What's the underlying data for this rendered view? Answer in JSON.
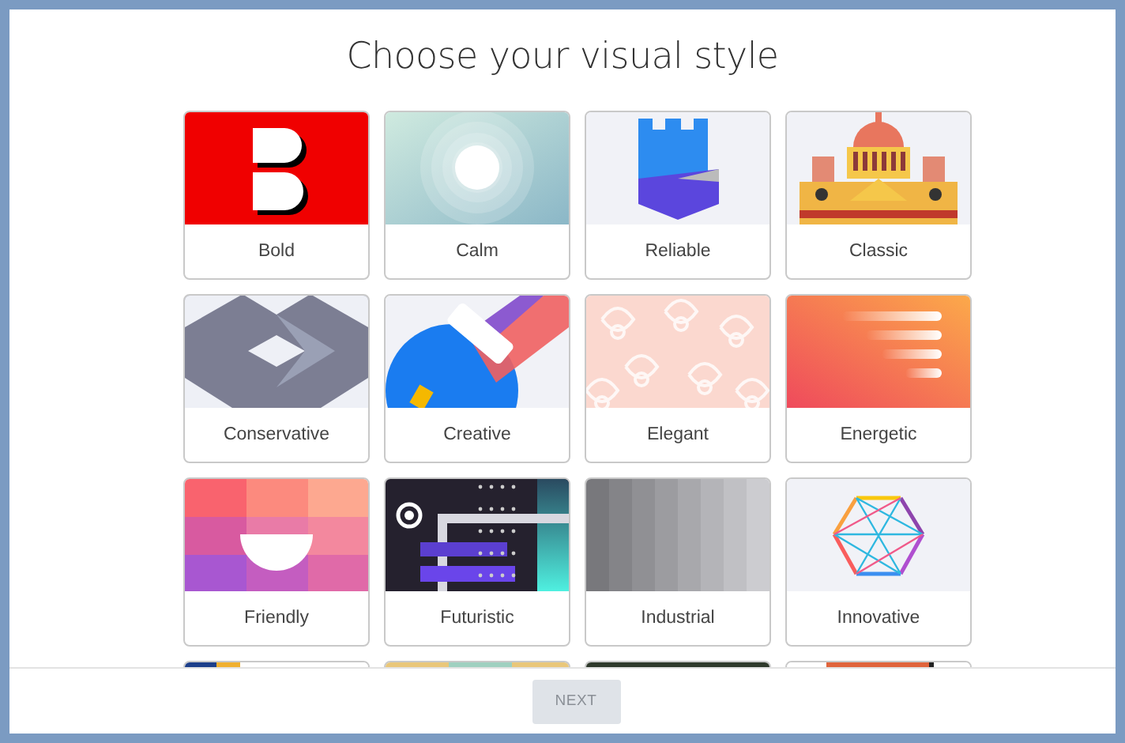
{
  "title": "Choose your visual style",
  "styles": [
    {
      "label": "Bold",
      "kind": "bold",
      "selected": false
    },
    {
      "label": "Calm",
      "kind": "calm",
      "selected": false
    },
    {
      "label": "Reliable",
      "kind": "reliable",
      "selected": false
    },
    {
      "label": "Classic",
      "kind": "classic",
      "selected": false
    },
    {
      "label": "Conservative",
      "kind": "conservative",
      "selected": false
    },
    {
      "label": "Creative",
      "kind": "creative",
      "selected": false
    },
    {
      "label": "Elegant",
      "kind": "elegant",
      "selected": false
    },
    {
      "label": "Energetic",
      "kind": "energetic",
      "selected": false
    },
    {
      "label": "Friendly",
      "kind": "friendly",
      "selected": false
    },
    {
      "label": "Futuristic",
      "kind": "futuristic",
      "selected": false
    },
    {
      "label": "Industrial",
      "kind": "industrial",
      "selected": false
    },
    {
      "label": "Innovative",
      "kind": "innovative",
      "selected": false
    }
  ],
  "partial_row": [
    {
      "kind": "navy-amber"
    },
    {
      "kind": "sand"
    },
    {
      "kind": "dark"
    },
    {
      "kind": "coral"
    }
  ],
  "next_button": {
    "label": "NEXT",
    "disabled": true
  }
}
